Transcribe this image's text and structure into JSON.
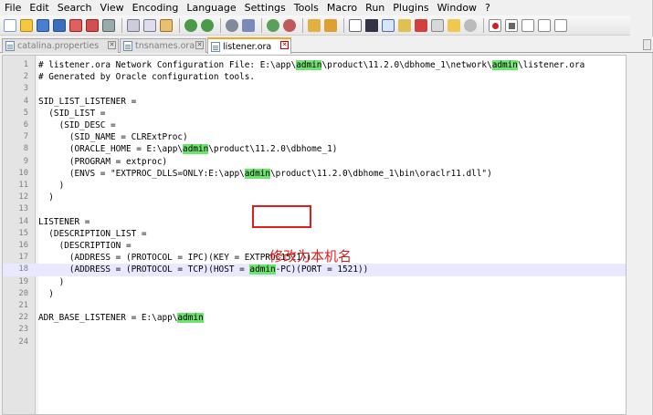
{
  "menu": [
    "File",
    "Edit",
    "Search",
    "View",
    "Encoding",
    "Language",
    "Settings",
    "Tools",
    "Macro",
    "Run",
    "Plugins",
    "Window",
    "?"
  ],
  "tabs": [
    {
      "label": "catalina.properties",
      "active": false
    },
    {
      "label": "tnsnames.ora",
      "active": false
    },
    {
      "label": "listener.ora",
      "active": true
    }
  ],
  "editor": {
    "current_line": 18,
    "highlight_word": "admin",
    "lines": [
      {
        "n": "1",
        "text": "# listener.ora Network Configuration File: E:\\app\\admin\\product\\11.2.0\\dbhome_1\\network\\admin\\listener.ora"
      },
      {
        "n": "2",
        "text": "# Generated by Oracle configuration tools."
      },
      {
        "n": "3",
        "text": ""
      },
      {
        "n": "4",
        "text": "SID_LIST_LISTENER ="
      },
      {
        "n": "5",
        "text": "  (SID_LIST ="
      },
      {
        "n": "6",
        "text": "    (SID_DESC ="
      },
      {
        "n": "7",
        "text": "      (SID_NAME = CLRExtProc)"
      },
      {
        "n": "8",
        "text": "      (ORACLE_HOME = E:\\app\\admin\\product\\11.2.0\\dbhome_1)"
      },
      {
        "n": "9",
        "text": "      (PROGRAM = extproc)"
      },
      {
        "n": "10",
        "text": "      (ENVS = \"EXTPROC_DLLS=ONLY:E:\\app\\admin\\product\\11.2.0\\dbhome_1\\bin\\oraclr11.dll\")"
      },
      {
        "n": "11",
        "text": "    )"
      },
      {
        "n": "12",
        "text": "  )"
      },
      {
        "n": "13",
        "text": ""
      },
      {
        "n": "14",
        "text": "LISTENER ="
      },
      {
        "n": "15",
        "text": "  (DESCRIPTION_LIST ="
      },
      {
        "n": "16",
        "text": "    (DESCRIPTION ="
      },
      {
        "n": "17",
        "text": "      (ADDRESS = (PROTOCOL = IPC)(KEY = EXTPROC1521))"
      },
      {
        "n": "18",
        "text": "      (ADDRESS = (PROTOCOL = TCP)(HOST = admin-PC)(PORT = 1521))"
      },
      {
        "n": "19",
        "text": "    )"
      },
      {
        "n": "20",
        "text": "  )"
      },
      {
        "n": "21",
        "text": ""
      },
      {
        "n": "22",
        "text": "ADR_BASE_LISTENER = E:\\app\\admin"
      },
      {
        "n": "23",
        "text": ""
      },
      {
        "n": "24",
        "text": ""
      }
    ]
  },
  "annotation": "修改为本机名",
  "colors": {
    "highlight": "#6fe36f",
    "annotation": "#e21c1c",
    "current_line": "#e8e8ff"
  }
}
